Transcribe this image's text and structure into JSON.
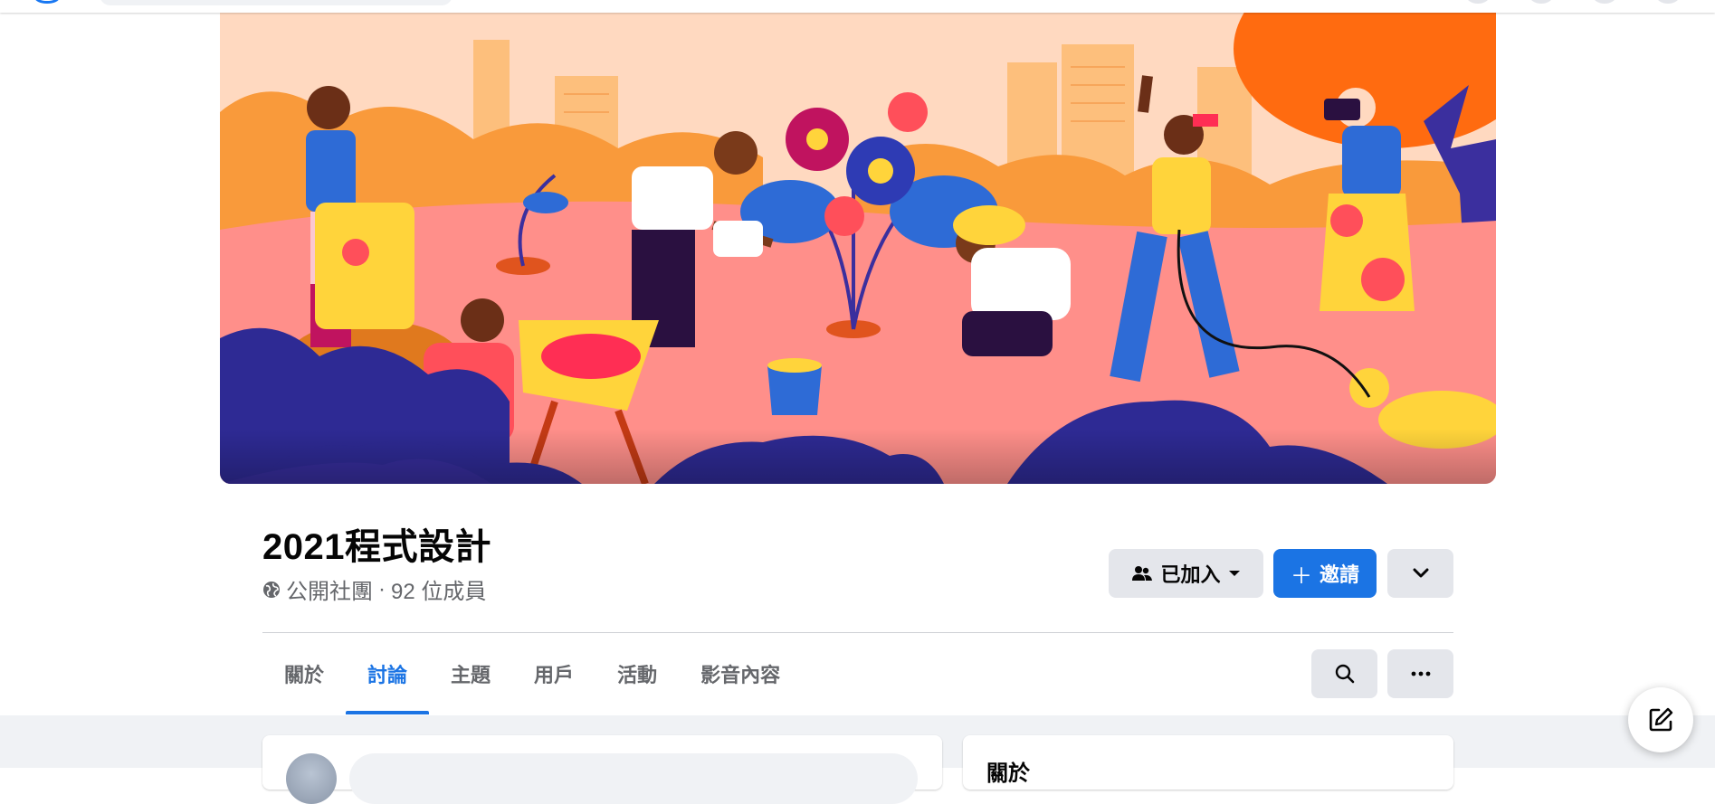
{
  "group": {
    "name": "2021程式設計",
    "privacy": "公開社團",
    "separator": "·",
    "members": "92 位成員"
  },
  "actions": {
    "joined_label": "已加入",
    "invite_label": "邀請",
    "invite_prefix": "＋"
  },
  "tabs": [
    {
      "label": "關於",
      "active": false
    },
    {
      "label": "討論",
      "active": true
    },
    {
      "label": "主題",
      "active": false
    },
    {
      "label": "用戶",
      "active": false
    },
    {
      "label": "活動",
      "active": false
    },
    {
      "label": "影音內容",
      "active": false
    }
  ],
  "right_panel": {
    "heading": "關於"
  },
  "icons": {
    "privacy": "globe-icon",
    "joined": "members-icon",
    "joined_caret": "caret-down-icon",
    "expand": "chevron-down-icon",
    "search": "search-icon",
    "more": "more-dots-icon",
    "compose": "compose-message-icon"
  },
  "colors": {
    "accent": "#1b74e4",
    "button_gray": "#e4e6eb",
    "muted_text": "#65676b",
    "feed_background": "#f0f2f5"
  }
}
